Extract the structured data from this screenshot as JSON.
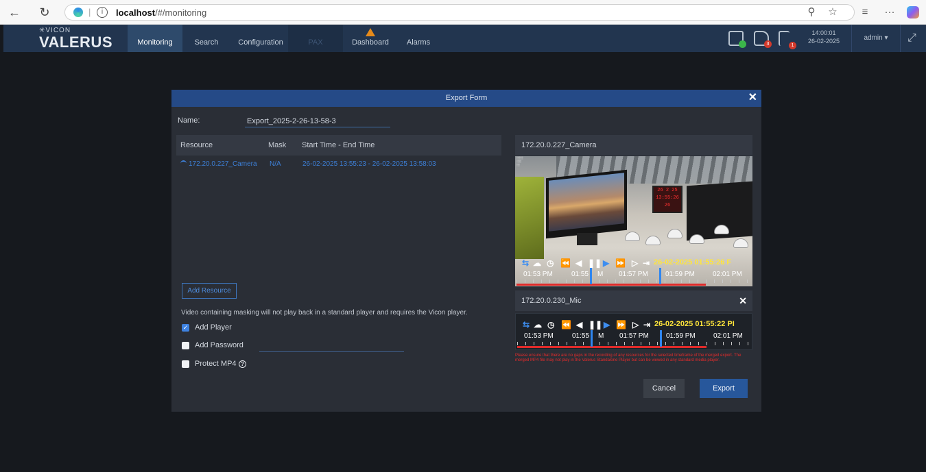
{
  "browser": {
    "url_host": "localhost",
    "url_path": "/#/monitoring"
  },
  "app": {
    "logo_top": "✳VICON",
    "logo_main": "VALERUS",
    "nav": [
      "Monitoring",
      "Search",
      "Configuration",
      "PAX",
      "Dashboard",
      "Alarms"
    ],
    "active_nav": "Monitoring",
    "badges": {
      "export": "3",
      "flag": "1"
    },
    "time": "14:00:01",
    "date": "26-02-2025",
    "user": "admin ▾",
    "colors": {
      "header": "#22354f",
      "accent": "#254a87",
      "warning": "#e68a1a",
      "badge_red": "#d33a2c",
      "badge_green": "#3bb54a"
    }
  },
  "modal": {
    "title": "Export Form",
    "close": "✕",
    "name_label": "Name:",
    "name_value": "Export_2025-2-26-13-58-3",
    "resource_headers": {
      "resource": "Resource",
      "mask": "Mask",
      "time": "Start Time - End Time"
    },
    "resources": [
      {
        "name": "172.20.0.227_Camera",
        "mask": "N/A",
        "time": "26-02-2025 13:55:23 - 26-02-2025 13:58:03"
      }
    ],
    "add_resource": "Add Resource",
    "info_text": "Video containing masking will not play back in a standard player and requires the Vicon player.",
    "options": {
      "add_player": {
        "label": "Add Player",
        "checked": true
      },
      "add_password": {
        "label": "Add Password",
        "checked": false
      },
      "protect_mp4": {
        "label": "Protect MP4",
        "checked": false
      }
    },
    "camera_panel": {
      "title": "172.20.0.227_Camera",
      "timestamp": "26-02-2025 01:55:26 F",
      "timeline": [
        "01:53 PM",
        "01:55",
        "M",
        "01:57 PM",
        "01:59 PM",
        "02:01 PM"
      ],
      "clock_lines": [
        "26 2 25",
        "13:55:26",
        "26"
      ]
    },
    "mic_panel": {
      "title": "172.20.0.230_Mic",
      "close": "✕",
      "timestamp": "26-02-2025 01:55:22 PI",
      "timeline": [
        "01:53 PM",
        "01:55",
        "M",
        "01:57 PM",
        "01:59 PM",
        "02:01 PM"
      ]
    },
    "warning_text": "Please ensure that there are no gaps in the recording of any resources for the selected timeframe of the merged export. The merged MP4 file may not play in the Valerus Standalone Player but can be viewed in any standard media player.",
    "cancel": "Cancel",
    "export": "Export"
  }
}
